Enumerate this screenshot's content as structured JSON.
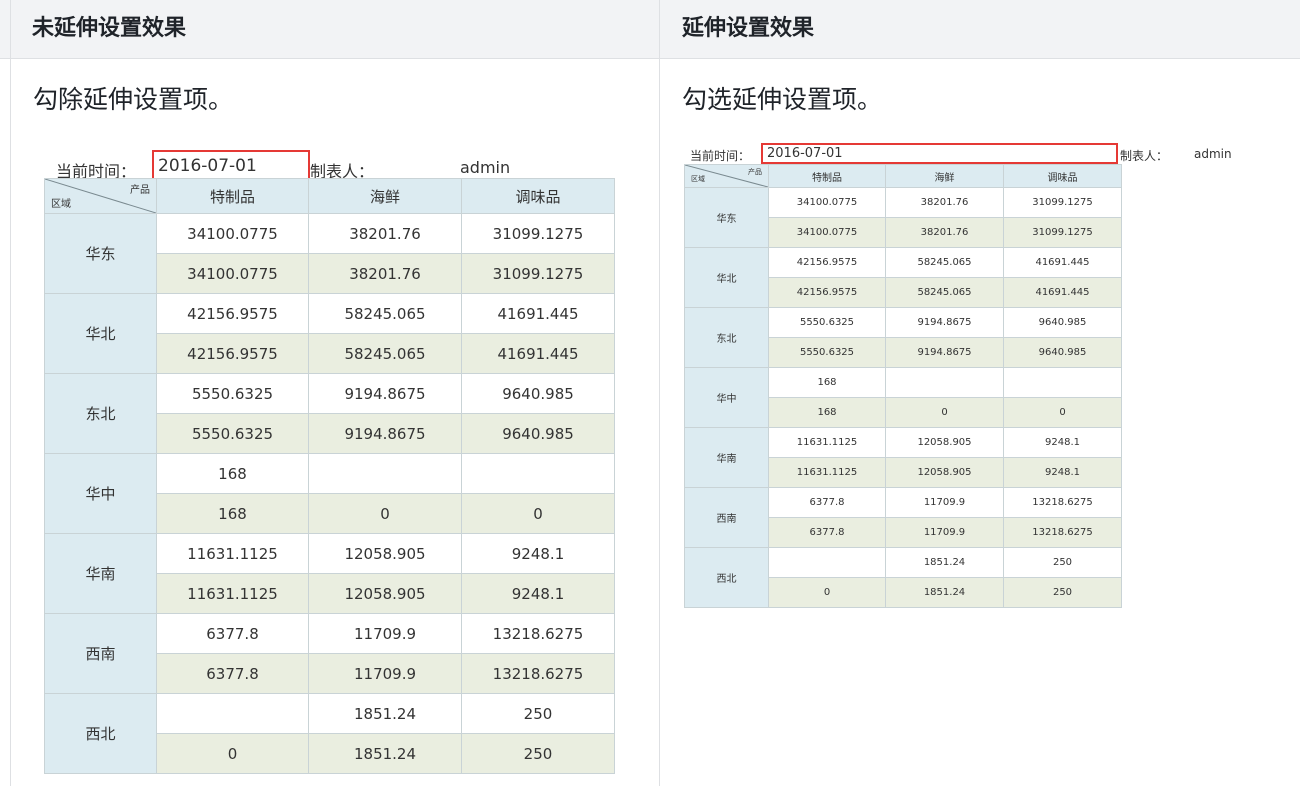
{
  "columns": {
    "left_header": "未延伸设置效果",
    "right_header": "延伸设置效果"
  },
  "left_note": "勾除延伸设置项。",
  "right_note": "勾选延伸设置项。",
  "report": {
    "date_label": "当前时间：",
    "date_value": "2016-07-01",
    "maker_label": "制表人：",
    "maker_value": "admin",
    "corner_product": "产品",
    "corner_region": "区域",
    "product_headers": [
      "特制品",
      "海鲜",
      "调味品"
    ],
    "regions": [
      {
        "name": "华东",
        "rows": [
          [
            "34100.0775",
            "38201.76",
            "31099.1275"
          ],
          [
            "34100.0775",
            "38201.76",
            "31099.1275"
          ]
        ]
      },
      {
        "name": "华北",
        "rows": [
          [
            "42156.9575",
            "58245.065",
            "41691.445"
          ],
          [
            "42156.9575",
            "58245.065",
            "41691.445"
          ]
        ]
      },
      {
        "name": "东北",
        "rows": [
          [
            "5550.6325",
            "9194.8675",
            "9640.985"
          ],
          [
            "5550.6325",
            "9194.8675",
            "9640.985"
          ]
        ]
      },
      {
        "name": "华中",
        "rows": [
          [
            "168",
            "",
            ""
          ],
          [
            "168",
            "0",
            "0"
          ]
        ]
      },
      {
        "name": "华南",
        "rows": [
          [
            "11631.1125",
            "12058.905",
            "9248.1"
          ],
          [
            "11631.1125",
            "12058.905",
            "9248.1"
          ]
        ]
      },
      {
        "name": "西南",
        "rows": [
          [
            "6377.8",
            "11709.9",
            "13218.6275"
          ],
          [
            "6377.8",
            "11709.9",
            "13218.6275"
          ]
        ]
      },
      {
        "name": "西北",
        "rows": [
          [
            "",
            "1851.24",
            "250"
          ],
          [
            "0",
            "1851.24",
            "250"
          ]
        ]
      }
    ]
  }
}
